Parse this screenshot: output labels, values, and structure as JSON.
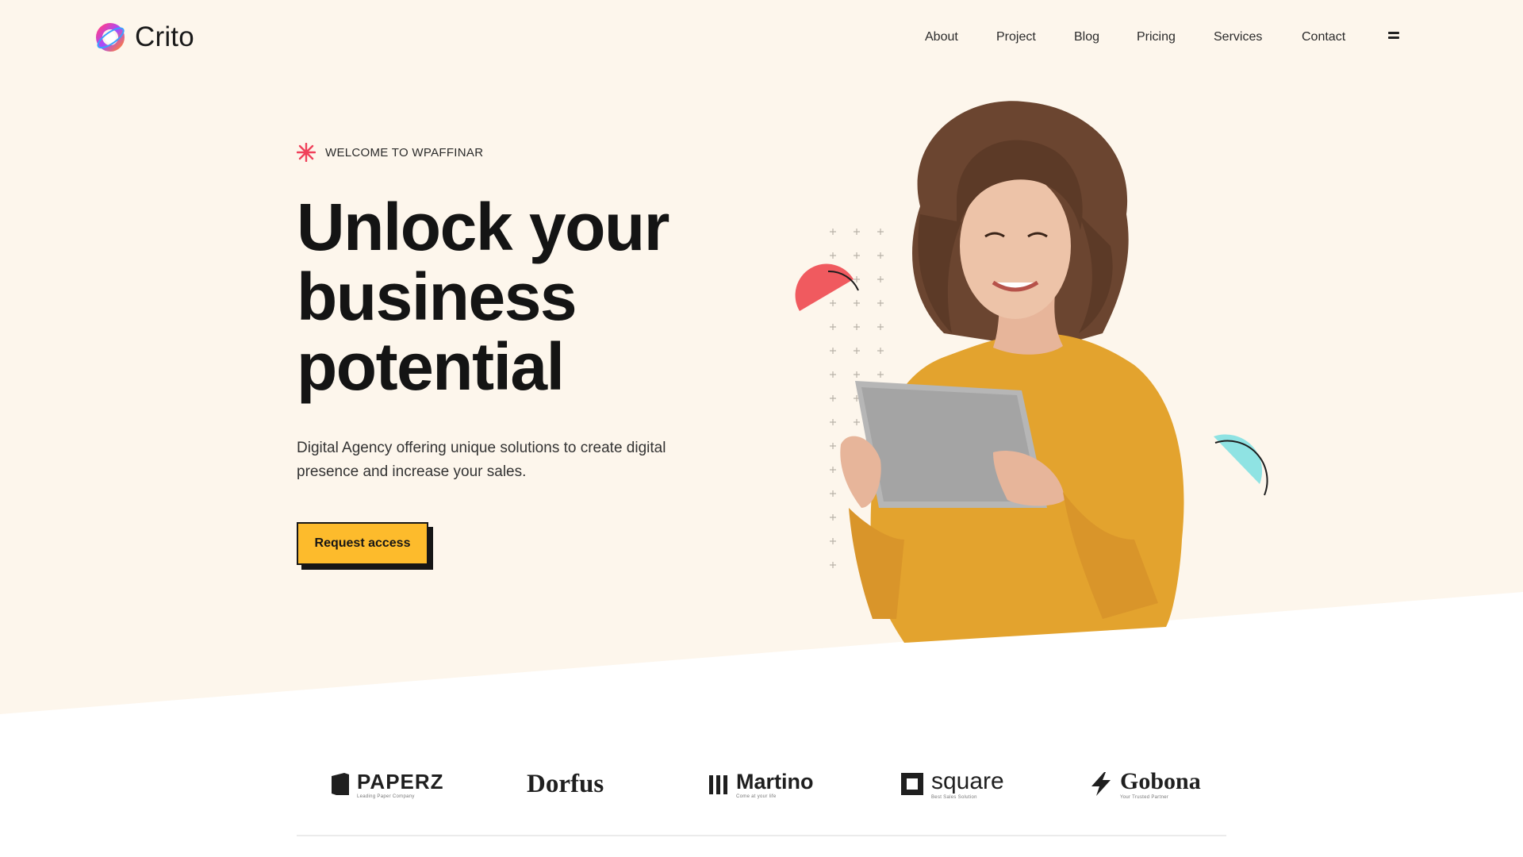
{
  "brand": {
    "name": "Crito",
    "logo_icon": "crito-ring-logo"
  },
  "nav": {
    "items": [
      "About",
      "Project",
      "Blog",
      "Pricing",
      "Services",
      "Contact"
    ],
    "menu_icon": "hamburger-icon"
  },
  "hero": {
    "eyebrow": "WELCOME TO WPAFFINAR",
    "eyebrow_icon": "starburst-icon",
    "headline": [
      "Unlock your",
      "business",
      "potential"
    ],
    "subtext": "Digital Agency offering unique solutions to create digital presence and increase your sales.",
    "cta_label": "Request access"
  },
  "partners": [
    {
      "name": "PAPERZ",
      "tagline": "Leading Paper Company",
      "icon": "book-icon"
    },
    {
      "name": "Dorfus",
      "tagline": "",
      "icon": ""
    },
    {
      "name": "Martino",
      "tagline": "Come at your life",
      "icon": "bars-icon"
    },
    {
      "name": "square",
      "tagline": "Best Sales Solution",
      "icon": "square-icon"
    },
    {
      "name": "Gobona",
      "tagline": "Your Trusted Partner",
      "icon": "bolt-icon"
    }
  ],
  "colors": {
    "hero_background": "#fdf6ec",
    "accent": "#fdbb2c",
    "coral": "#f05a5f",
    "cyan": "#8fe3e3",
    "sweater": "#e3a32e"
  }
}
